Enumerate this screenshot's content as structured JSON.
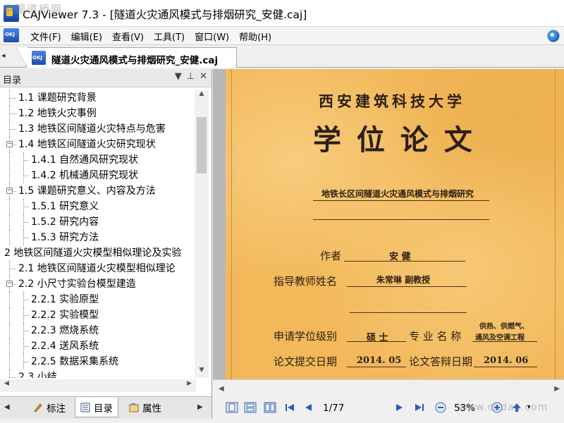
{
  "window": {
    "title": "CAJViewer 7.3 - [隧道火灾通风模式与排烟研究_安健.caj]"
  },
  "menu": {
    "items": [
      "文件(F)",
      "编辑(E)",
      "查看(V)",
      "工具(T)",
      "窗口(W)",
      "帮助(H)"
    ]
  },
  "doc_tab": {
    "label": "隧道火灾通风模式与排烟研究_安健.caj"
  },
  "side_panel": {
    "title": "目录",
    "toc": [
      {
        "text": "1.1 课题研究背景",
        "level": 1,
        "expandable": false
      },
      {
        "text": "1.2 地铁火灾事例",
        "level": 1,
        "expandable": false
      },
      {
        "text": "1.3 地铁区间隧道火灾特点与危害",
        "level": 1,
        "expandable": false
      },
      {
        "text": "1.4 地铁区间隧道火灾研究现状",
        "level": 1,
        "expandable": true
      },
      {
        "text": "1.4.1 自然通风研究现状",
        "level": 2,
        "expandable": false
      },
      {
        "text": "1.4.2 机械通风研究现状",
        "level": 2,
        "expandable": false
      },
      {
        "text": "1.5 课题研究意义、内容及方法",
        "level": 1,
        "expandable": true
      },
      {
        "text": "1.5.1 研究意义",
        "level": 2,
        "expandable": false
      },
      {
        "text": "1.5.2 研究内容",
        "level": 2,
        "expandable": false
      },
      {
        "text": "1.5.3 研究方法",
        "level": 2,
        "expandable": false
      },
      {
        "text": "2 地铁区间隧道火灾模型相似理论及实验",
        "level": 0,
        "expandable": false
      },
      {
        "text": "2.1 地铁区间隧道火灾模型相似理论",
        "level": 1,
        "expandable": false
      },
      {
        "text": "2.2 小尺寸实验台模型建造",
        "level": 1,
        "expandable": true
      },
      {
        "text": "2.2.1 实验原型",
        "level": 2,
        "expandable": false
      },
      {
        "text": "2.2.2 实验模型",
        "level": 2,
        "expandable": false
      },
      {
        "text": "2.2.3 燃烧系统",
        "level": 2,
        "expandable": false
      },
      {
        "text": "2.2.4 送风系统",
        "level": 2,
        "expandable": false
      },
      {
        "text": "2.2.5 数据采集系统",
        "level": 2,
        "expandable": false
      },
      {
        "text": "2.3 小结",
        "level": 1,
        "expandable": false
      }
    ],
    "tabs": [
      {
        "label": "标注",
        "icon": "annotation-icon"
      },
      {
        "label": "目录",
        "icon": "toc-icon"
      },
      {
        "label": "属性",
        "icon": "properties-icon"
      }
    ],
    "active_tab": "目录"
  },
  "page": {
    "university": "西安建筑科技大学",
    "heading": "学 位 论 文",
    "thesis_title": "地铁长区间隧道火灾通风模式与排烟研究",
    "author_label": "作者",
    "author": "安   健",
    "advisor_label": "指导教师姓名",
    "advisor": "朱常琳  副教授",
    "degree_label": "申请学位级别",
    "degree": "硕 士",
    "major_label": "专 业 名 称",
    "major_line1": "供热、供燃气、",
    "major_line2": "通风及空调工程",
    "submit_label": "论文提交日期",
    "submit_date": "2014. 05",
    "defense_label": "论文答辩日期",
    "defense_date": "2014. 06"
  },
  "navigation": {
    "page_indicator": "1/77",
    "zoom": "53%"
  },
  "watermarks": {
    "top_left": "中国道桥网",
    "bottom_right": "www.cndao.com"
  }
}
